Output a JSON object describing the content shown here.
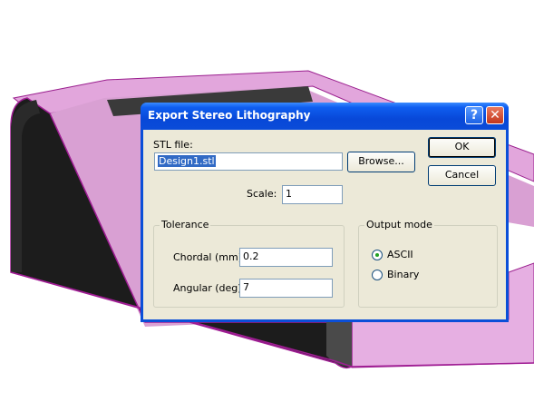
{
  "dialog": {
    "title": "Export Stereo Lithography",
    "help_glyph": "?",
    "close_glyph": "✕"
  },
  "stl": {
    "label": "STL file:",
    "value": "Design1.stl",
    "browse_label": "Browse..."
  },
  "buttons": {
    "ok": "OK",
    "cancel": "Cancel"
  },
  "scale": {
    "label": "Scale:",
    "value": "1"
  },
  "tolerance": {
    "title": "Tolerance",
    "chordal_label": "Chordal (mm):",
    "chordal_value": "0.2",
    "angular_label": "Angular (deg):",
    "angular_value": "7"
  },
  "output_mode": {
    "title": "Output mode",
    "options": [
      {
        "label": "ASCII",
        "selected": true
      },
      {
        "label": "Binary",
        "selected": false
      }
    ]
  },
  "colors": {
    "titlebar": "#0a4cd9",
    "dialog_bg": "#ece9d8",
    "model_body": "#e2a6dc",
    "model_wall": "#1e1e1e",
    "background": "#ffffff"
  }
}
